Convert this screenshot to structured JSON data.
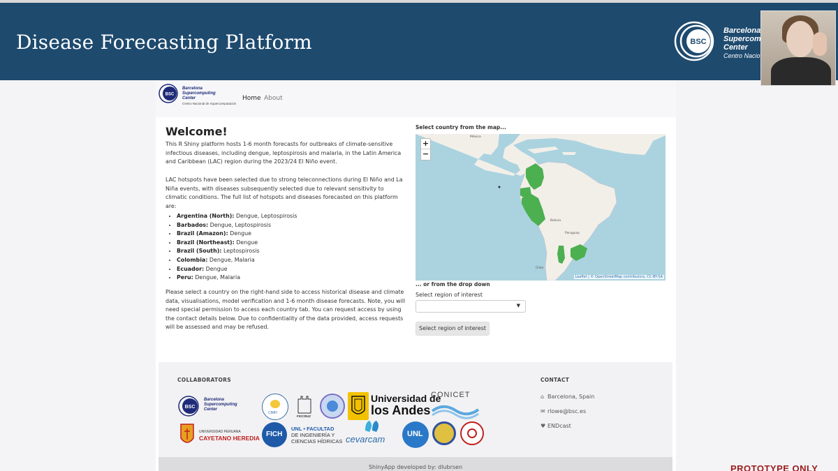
{
  "banner": {
    "title": "Disease Forecasting Platform",
    "org_line1": "Barcelona",
    "org_line2": "Supercom",
    "org_line3": "Center",
    "org_line4": "Centro Nacio",
    "logo_text": "BSC",
    "background": "#1e4a6e"
  },
  "navbar": {
    "logo_text": "BSC",
    "org_line1": "Barcelona",
    "org_line2": "Supercomputing",
    "org_line3": "Center",
    "org_line4": "Centro Nacional de Supercomputación",
    "home": "Home",
    "about": "About"
  },
  "main": {
    "heading": "Welcome!",
    "p1": "This R Shiny platform hosts 1-6 month forecasts for outbreaks of climate-sensitive infectious diseases, including dengue, leptospirosis and malaria, in the Latin America and Caribbean (LAC) region during the 2023/24 El Niño event.",
    "p2": "LAC hotspots have been selected due to strong teleconnections during El Niño and La Niña events, with diseases subsequently selected due to relevant sensitivity to climatic conditions. The full list of hotspots and diseases forecasted on this platform are:",
    "hotspots": [
      {
        "region": "Argentina (North):",
        "diseases": " Dengue, Leptospirosis"
      },
      {
        "region": "Barbados:",
        "diseases": " Dengue, Leptospirosis"
      },
      {
        "region": "Brazil (Amazon):",
        "diseases": " Dengue"
      },
      {
        "region": "Brazil (Northeast):",
        "diseases": " Dengue"
      },
      {
        "region": "Brazil (South):",
        "diseases": " Leptospirosis"
      },
      {
        "region": "Colombia:",
        "diseases": " Dengue, Malaria"
      },
      {
        "region": "Ecuador:",
        "diseases": " Dengue"
      },
      {
        "region": "Peru:",
        "diseases": " Dengue, Malaria"
      }
    ],
    "p3": "Please select a country on the right-hand side to access historical disease and climate data, visualisations, model verification and 1-6 month disease forecasts. Note, you will need special permission to access each country tab. You can request access by using the contact details below. Due to confidentiality of the data provided, access requests will be assessed and may be refused."
  },
  "map": {
    "label": "Select country from the map...",
    "zoom_in": "+",
    "zoom_out": "−",
    "attribution": "Leaflet | © OpenStreetMap contributors, CC-BY-SA",
    "place_labels": [
      "México",
      "Bolivia",
      "Paraguay",
      "Chile"
    ],
    "highlight_color": "#4caf50"
  },
  "dropdown": {
    "label": "... or from the drop down",
    "select_label": "Select region of interest",
    "value": "",
    "button": "Select region of interest"
  },
  "footer": {
    "collaborators_heading": "COLLABORATORS",
    "contact_heading": "CONTACT",
    "contacts": [
      {
        "icon": "home-icon",
        "text": "Barcelona, Spain"
      },
      {
        "icon": "envelope-icon",
        "text": "rlowe@bsc.es"
      },
      {
        "icon": "heart-icon",
        "text": "ENDcast"
      }
    ],
    "logos": {
      "bsc": "BSC",
      "bsc_line1": "Barcelona",
      "bsc_line2": "Supercomputing",
      "bsc_line3": "Center",
      "cimh": "CIMH",
      "fiocruz": "FIOCRUZ",
      "uniandes_1": "Universidad de",
      "uniandes_2": "los Andes",
      "conicet": "CONICET",
      "cayetano_1": "UNIVERSIDAD PERUANA",
      "cayetano_2": "CAYETANO HEREDIA",
      "fich": "FICH",
      "unl_1": "UNL • FACULTAD",
      "unl_2": "DE INGENIERÍA Y",
      "unl_3": "CIENCIAS HÍDRICAS",
      "cevarcam": "cevarcam",
      "unl": "UNL"
    },
    "credit": "ShinyApp developed by: dlubrsen"
  },
  "watermark": "PROTOTYPE ONLY"
}
